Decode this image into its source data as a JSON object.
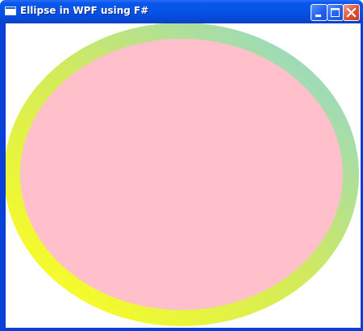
{
  "window": {
    "title": "Ellipse in WPF using F#"
  },
  "title_icon": "window-icon",
  "caption_buttons": [
    {
      "name": "minimize",
      "icon": "minimize-icon"
    },
    {
      "name": "maximize",
      "icon": "maximize-icon"
    },
    {
      "name": "close",
      "icon": "close-icon"
    }
  ],
  "ellipse": {
    "fill_color": "#ffc0cb",
    "stroke_gradient_start": "#ffff1e",
    "stroke_gradient_end": "#8fd6d2"
  },
  "colors": {
    "titlebar": "#0553e6",
    "frame": "#0a3fd8",
    "close_button": "#e0563a",
    "window_background": "#ffffff"
  }
}
